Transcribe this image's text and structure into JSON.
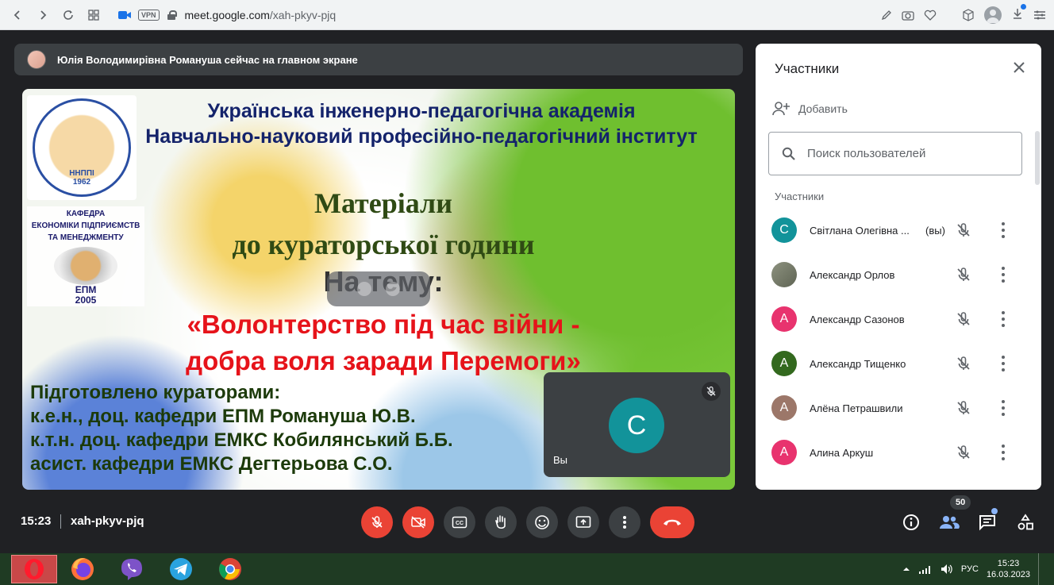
{
  "browser": {
    "url_host": "meet.google.com",
    "url_path": "/xah-pkyv-pjq",
    "vpn_label": "VPN"
  },
  "banner": {
    "text": "Юлія Володимирівна Романуша сейчас на главном экране"
  },
  "slide": {
    "header_line1": "Українська інженерно-педагогічна академія",
    "header_line2": "Навчально-науковий професійно-педагогічний інститут",
    "title_line1": "Матеріали",
    "title_line2": "до кураторської години",
    "topic": "На тему:",
    "quote_line1": "«Волонтерство під час війни -",
    "quote_line2": "добра воля заради Перемоги»",
    "prepared_line1": "Підготовлено кураторами:",
    "prepared_line2": "к.е.н., доц. кафедри ЕПМ Романуша Ю.В.",
    "prepared_line3": "к.т.н. доц. кафедри ЕМКС Кобилянський Б.Б.",
    "prepared_line4": "асист. кафедри ЕМКС Дегтерьова С.О.",
    "logo1_text": "ННППІ",
    "logo1_year": "1962",
    "logo2_line1": "КАФЕДРА",
    "logo2_line2": "ЕКОНОМІКИ ПІДПРИЄМСТВ",
    "logo2_line3": "ТА МЕНЕДЖМЕНТУ",
    "logo2_abbr": "ЕПМ",
    "logo2_year": "2005"
  },
  "self_tile": {
    "initial": "С",
    "label": "Вы",
    "avatar_color": "#12939a"
  },
  "panel": {
    "title": "Участники",
    "add_label": "Добавить",
    "search_placeholder": "Поиск пользователей",
    "section_label": "Участники",
    "participants": [
      {
        "initial": "С",
        "name": "Світлана Олегівна ...",
        "you": "(вы)",
        "color": "#12939a"
      },
      {
        "initial": "",
        "name": "Александр Орлов",
        "you": "",
        "color": "#7a7f74"
      },
      {
        "initial": "А",
        "name": "Александр Сазонов",
        "you": "",
        "color": "#e8336e"
      },
      {
        "initial": "А",
        "name": "Александр Тищенко",
        "you": "",
        "color": "#33691e"
      },
      {
        "initial": "А",
        "name": "Алёна Петрашвили",
        "you": "",
        "color": "#9c7769"
      },
      {
        "initial": "А",
        "name": "Алина Аркуш",
        "you": "",
        "color": "#e8336e"
      }
    ]
  },
  "meetbar": {
    "time": "15:23",
    "code": "xah-pkyv-pjq",
    "participant_count": "50"
  },
  "taskbar": {
    "lang": "РУС",
    "time": "15:23",
    "date": "16.03.2023"
  }
}
